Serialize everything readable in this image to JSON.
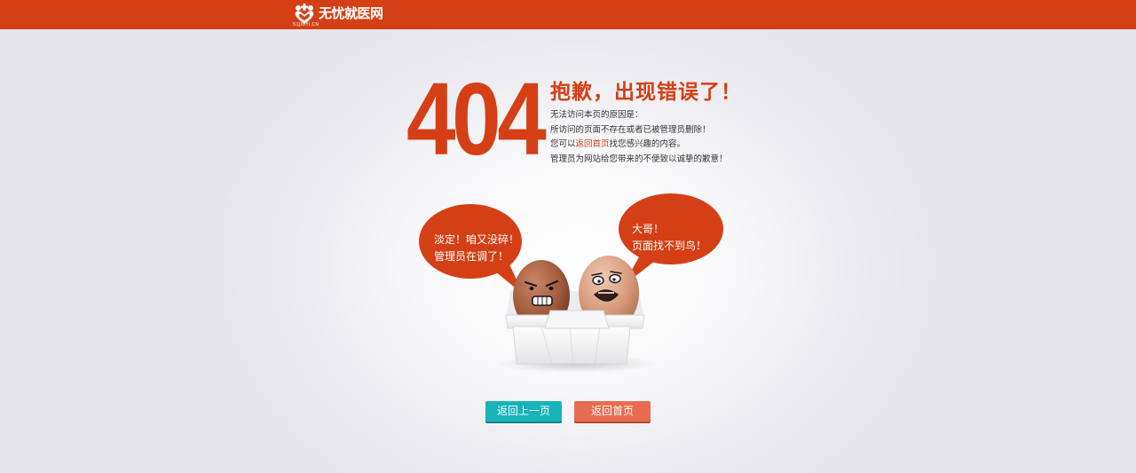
{
  "header": {
    "brand_name": "无忧就医网",
    "brand_sub": "51JIUYI.CN",
    "brand_color": "#d43f16"
  },
  "error": {
    "code": "404",
    "title": "抱歉，出现错误了！",
    "reason_heading": "无法访问本页的原因是：",
    "reason_1": "所访问的页面不存在或者已被管理员删除！",
    "reason_2_prefix": "您可以",
    "reason_2_link": "返回首页",
    "reason_2_suffix": "找您感兴趣的内容。",
    "reason_3": "管理员为网站给您带来的不便致以诚挚的歉意！"
  },
  "illustration": {
    "left_bubble_line1": "淡定！咱又没碎！",
    "left_bubble_line2": "管理员在调了！",
    "right_bubble_line1": "大哥！",
    "right_bubble_line2": "页面找不到鸟！"
  },
  "actions": {
    "back_label": "返回上一页",
    "home_label": "返回首页",
    "back_color": "#18b4ba",
    "home_color": "#e86c4f"
  }
}
